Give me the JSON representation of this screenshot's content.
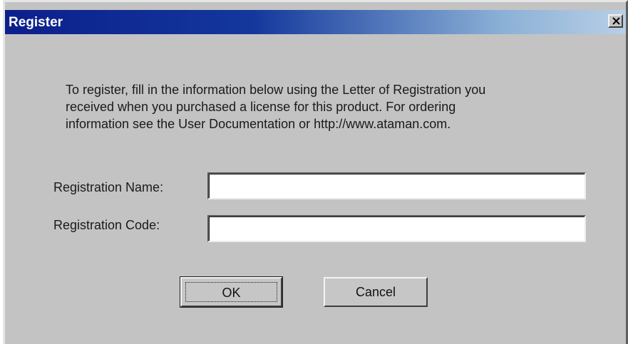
{
  "window": {
    "title": "Register"
  },
  "intro": {
    "lines": [
      "To register, fill in the information below using the Letter of Registration you",
      "received when you purchased a license for this product. For ordering",
      "information see the User Documentation or http://www.ataman.com."
    ]
  },
  "form": {
    "name_label": "Registration Name:",
    "name_value": "",
    "code_label": "Registration Code:",
    "code_value": ""
  },
  "buttons": {
    "ok_label": "OK",
    "cancel_label": "Cancel"
  },
  "icons": {
    "close": "close-icon"
  },
  "colors": {
    "titlebar_start": "#0c1f8c",
    "titlebar_end": "#b8cfe6",
    "dialog_background": "#c3c3c3"
  }
}
